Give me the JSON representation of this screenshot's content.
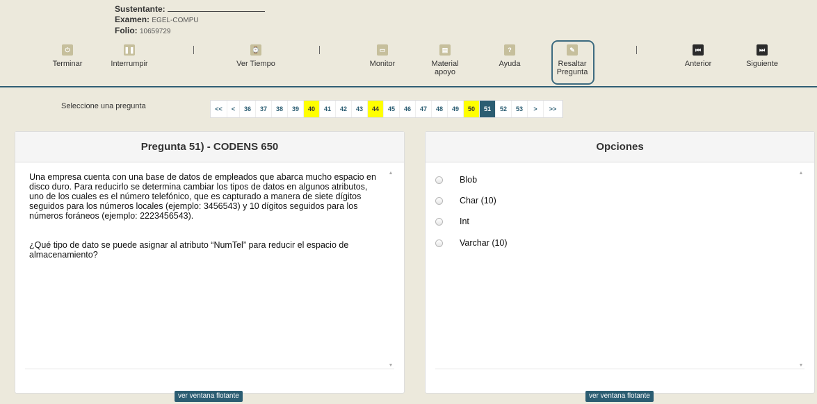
{
  "header": {
    "sustentante_label": "Sustentante:",
    "examen_label": "Examen:",
    "examen_value": "EGEL-COMPU",
    "folio_label": "Folio:",
    "folio_value": "10659729",
    "tools": {
      "terminar": "Terminar",
      "interrumpir": "Interrumpir",
      "ver_tiempo": "Ver Tiempo",
      "monitor": "Monitor",
      "material_line1": "Material",
      "material_line2": "apoyo",
      "ayuda": "Ayuda",
      "ayuda_glyph": "?",
      "resaltar_line1": "Resaltar",
      "resaltar_line2": "Pregunta",
      "anterior": "Anterior",
      "siguiente": "Siguiente"
    },
    "separator": "|"
  },
  "pager": {
    "label": "Seleccione una pregunta",
    "items": [
      {
        "label": "<<",
        "state": "nav"
      },
      {
        "label": "<",
        "state": "nav"
      },
      {
        "label": "36",
        "state": "normal"
      },
      {
        "label": "37",
        "state": "normal"
      },
      {
        "label": "38",
        "state": "normal"
      },
      {
        "label": "39",
        "state": "normal"
      },
      {
        "label": "40",
        "state": "marked"
      },
      {
        "label": "41",
        "state": "normal"
      },
      {
        "label": "42",
        "state": "normal"
      },
      {
        "label": "43",
        "state": "normal"
      },
      {
        "label": "44",
        "state": "marked"
      },
      {
        "label": "45",
        "state": "normal"
      },
      {
        "label": "46",
        "state": "normal"
      },
      {
        "label": "47",
        "state": "normal"
      },
      {
        "label": "48",
        "state": "normal"
      },
      {
        "label": "49",
        "state": "normal"
      },
      {
        "label": "50",
        "state": "marked"
      },
      {
        "label": "51",
        "state": "active"
      },
      {
        "label": "52",
        "state": "normal"
      },
      {
        "label": "53",
        "state": "normal"
      },
      {
        "label": ">",
        "state": "nav"
      },
      {
        "label": ">>",
        "state": "nav"
      }
    ],
    "colors": {
      "marked": "#ffff00",
      "active": "#2b5d72"
    }
  },
  "question": {
    "title": "Pregunta 51) - CODENS 650",
    "paragraph1": "Una empresa cuenta con una base de datos de empleados que abarca mucho espacio en disco duro. Para reducirlo se determina cambiar los tipos de datos en algunos atributos, uno de los cuales es el número telefónico, que es capturado a manera de siete dígitos seguidos para los números locales (ejemplo: 3456543) y 10 dígitos seguidos para los números foráneos (ejemplo: 2223456543).",
    "paragraph2": "¿Qué tipo de dato se puede asignar al atributo “NumTel” para reducir el espacio de almacenamiento?",
    "float_button": "ver ventana flotante"
  },
  "options": {
    "title": "Opciones",
    "items": [
      "Blob",
      "Char (10)",
      "Int",
      "Varchar (10)"
    ],
    "float_button": "ver ventana flotante"
  },
  "theme": {
    "accent": "#2b5d72",
    "background": "#ece9dc"
  }
}
